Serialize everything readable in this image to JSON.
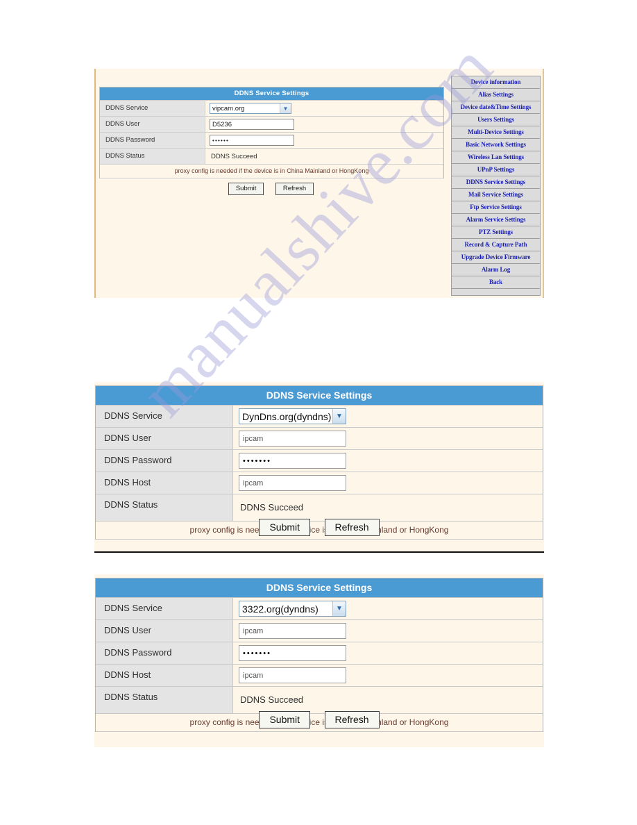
{
  "colors": {
    "titlebar": "#4a9ad4",
    "panel_bg": "#fdf6e9",
    "label_bg": "#e4e4e4",
    "sidebar_bg": "#dcdcdc",
    "sidebar_link": "#1b21b5",
    "note_text": "#6a3b2e",
    "watermark": "#9a9ad8"
  },
  "watermark": {
    "text": "manualshive.com"
  },
  "panel1": {
    "title": "DDNS Service Settings",
    "rows": [
      {
        "label": "DDNS Service",
        "type": "select",
        "value": "vipcam.org"
      },
      {
        "label": "DDNS User",
        "type": "text",
        "value": "D5236"
      },
      {
        "label": "DDNS Password",
        "type": "password",
        "value": "••••••"
      },
      {
        "label": "DDNS Status",
        "type": "status",
        "value": "DDNS Succeed"
      }
    ],
    "note": "proxy config is needed if the device is in China Mainland or HongKong",
    "buttons": {
      "submit": "Submit",
      "refresh": "Refresh"
    },
    "sidebar": {
      "items": [
        "Device information",
        "Alias Settings",
        "Device date&Time Settings",
        "Users Settings",
        "Multi-Device Settings",
        "Basic Network Settings",
        "Wireless Lan Settings",
        "UPnP Settings",
        "DDNS Service Settings",
        "Mail Service Settings",
        "Ftp Service Settings",
        "Alarm Service Settings",
        "PTZ Settings",
        "Record & Capture Path",
        "Upgrade Device Firmware",
        "Alarm Log",
        "Back"
      ]
    }
  },
  "panel2": {
    "title": "DDNS Service Settings",
    "rows": [
      {
        "label": "DDNS Service",
        "type": "select",
        "value": "DynDns.org(dyndns)"
      },
      {
        "label": "DDNS User",
        "type": "text",
        "value": "ipcam"
      },
      {
        "label": "DDNS Password",
        "type": "password",
        "value": "•••••••"
      },
      {
        "label": "DDNS Host",
        "type": "text",
        "value": "ipcam"
      },
      {
        "label": "DDNS Status",
        "type": "status",
        "value": "DDNS Succeed"
      }
    ],
    "note": "proxy config is needed if the device is in China Mainland or HongKong",
    "buttons": {
      "submit": "Submit",
      "refresh": "Refresh"
    }
  },
  "panel3": {
    "title": "DDNS Service Settings",
    "rows": [
      {
        "label": "DDNS Service",
        "type": "select",
        "value": "3322.org(dyndns)"
      },
      {
        "label": "DDNS User",
        "type": "text",
        "value": "ipcam"
      },
      {
        "label": "DDNS Password",
        "type": "password",
        "value": "•••••••"
      },
      {
        "label": "DDNS Host",
        "type": "text",
        "value": "ipcam"
      },
      {
        "label": "DDNS Status",
        "type": "status",
        "value": "DDNS Succeed"
      }
    ],
    "note": "proxy config is needed if the device is in China Mainland or HongKong",
    "buttons": {
      "submit": "Submit",
      "refresh": "Refresh"
    }
  }
}
